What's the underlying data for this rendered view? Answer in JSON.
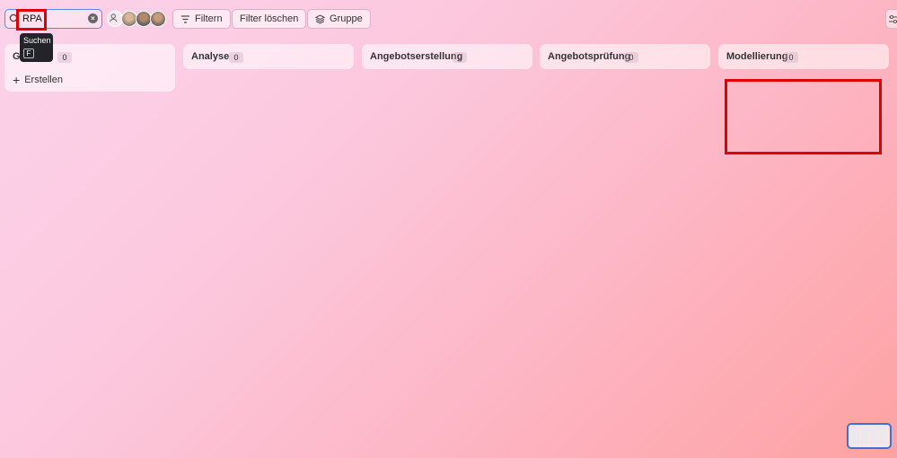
{
  "search": {
    "value": "RPA",
    "tooltip_label": "Suchen",
    "tooltip_shortcut": "F"
  },
  "toolbar": {
    "filter_label": "Filtern",
    "clear_filter_label": "Filter löschen",
    "group_label": "Gruppe"
  },
  "columns": [
    {
      "title": "G",
      "count": "0",
      "create_label": "Erstellen"
    },
    {
      "title": "Analyse",
      "count": "0"
    },
    {
      "title": "Angebotserstellung",
      "count": "0"
    },
    {
      "title": "Angebotsprüfung",
      "count": "0"
    },
    {
      "title": "Modellierung",
      "count": "0"
    }
  ],
  "colors": {
    "highlight": "#e00000",
    "focus": "#5a8be0"
  }
}
